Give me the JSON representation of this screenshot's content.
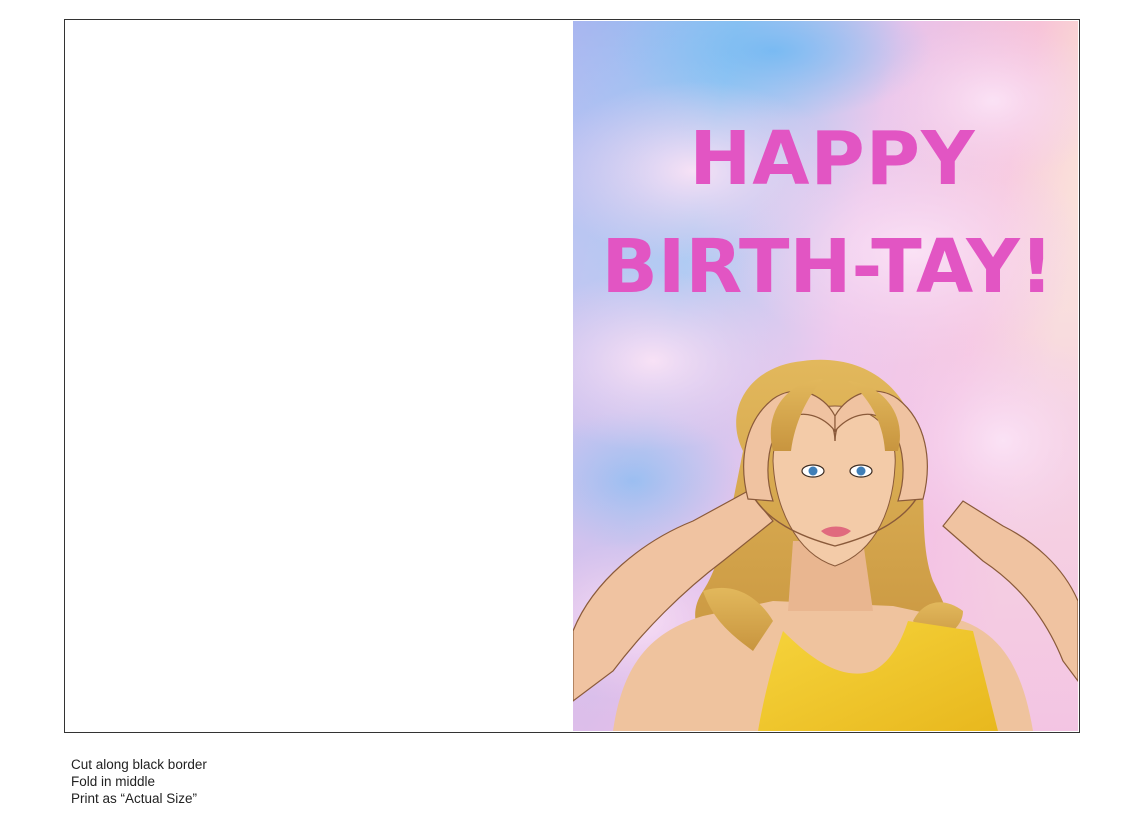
{
  "card": {
    "greeting_line1": "HAPPY",
    "greeting_line2": "BIRTH-TAY!",
    "colors": {
      "greeting_text": "#e255c3",
      "sky_blue": "#7fb8f0",
      "cloud_pink": "#f2c6e6",
      "dress_yellow": "#f2c62a",
      "hair_blonde": "#d4a449"
    }
  },
  "instructions": {
    "line1": "Cut along black border",
    "line2": "Fold in middle",
    "line3": "Print as “Actual Size”"
  }
}
